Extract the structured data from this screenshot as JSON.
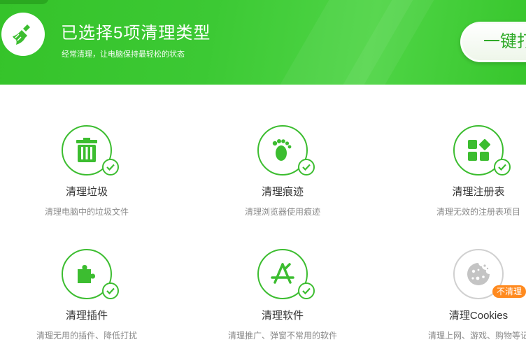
{
  "header": {
    "title": "已选择5项清理类型",
    "subtitle": "经常清理，让电脑保持最轻松的状态",
    "onekey_label": "一键打",
    "accent": "#3cc934",
    "icon": "broom-icon"
  },
  "items": [
    {
      "title": "清理垃圾",
      "desc": "清理电脑中的垃圾文件",
      "icon": "trash-icon",
      "selected": true
    },
    {
      "title": "清理痕迹",
      "desc": "清理浏览器使用痕迹",
      "icon": "footprint-icon",
      "selected": true
    },
    {
      "title": "清理注册表",
      "desc": "清理无效的注册表项目",
      "icon": "registry-icon",
      "selected": true
    },
    {
      "title": "清理插件",
      "desc": "清理无用的插件、降低打扰",
      "icon": "plugin-icon",
      "selected": true
    },
    {
      "title": "清理软件",
      "desc": "清理推广、弹窗不常用的软件",
      "icon": "software-icon",
      "selected": true
    },
    {
      "title": "清理Cookies",
      "desc": "清理上网、游戏、购物等记",
      "icon": "cookie-icon",
      "selected": false,
      "badge": "不清理"
    }
  ],
  "colors": {
    "check": "#3cbd30",
    "badge": "#ff8a1f",
    "disabled": "#d0d0d0"
  }
}
